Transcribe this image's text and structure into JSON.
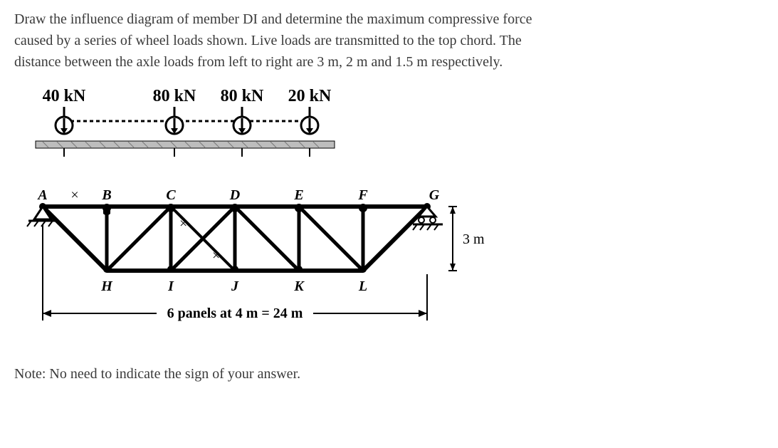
{
  "problem": {
    "line1": "Draw the influence diagram of member DI and determine the maximum compressive force",
    "line2": "caused by a series of wheel loads shown. Live loads are transmitted to the top chord. The",
    "line3": "distance between the axle loads from left to right are 3 m, 2 m and 1.5 m respectively."
  },
  "loads": {
    "P1": "40 kN",
    "P2": "80 kN",
    "P3": "80 kN",
    "P4": "20 kN",
    "spacings_m": [
      3,
      2,
      1.5
    ]
  },
  "truss": {
    "top_nodes": [
      "A",
      "B",
      "C",
      "D",
      "E",
      "F",
      "G"
    ],
    "bottom_nodes": [
      "H",
      "I",
      "J",
      "K",
      "L"
    ],
    "height_label": "3 m",
    "span_label": "6 panels at 4 m = 24 m",
    "panel_length_m": 4,
    "num_panels": 6,
    "span_m": 24,
    "height_m": 3
  },
  "note": "Note: No need to indicate the sign of your answer.",
  "chart_data": {
    "type": "diagram",
    "description": "Pratt-style through truss with 6 panels on top chord (A..G) and 5 bottom nodes (H..L). Moving wheel-load train of 40,80,80,20 kN with gaps 3,2,1.5 m acts on top chord.",
    "top_chord_x_m": [
      0,
      4,
      8,
      12,
      16,
      20,
      24
    ],
    "bottom_chord_x_m": [
      4,
      8,
      12,
      16,
      20
    ],
    "height_m": 3,
    "member_of_interest": "DI",
    "wheel_loads_kN": [
      40,
      80,
      80,
      20
    ],
    "wheel_spacings_m": [
      3,
      2,
      1.5
    ]
  }
}
